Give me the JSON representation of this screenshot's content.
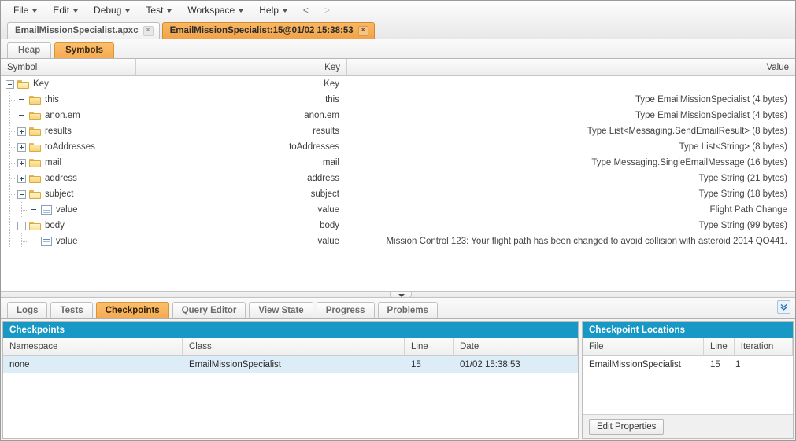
{
  "menubar": {
    "items": [
      {
        "label": "File",
        "caret": true
      },
      {
        "label": "Edit",
        "caret": true
      },
      {
        "label": "Debug",
        "caret": true
      },
      {
        "label": "Test",
        "caret": true
      },
      {
        "label": "Workspace",
        "caret": true
      },
      {
        "label": "Help",
        "caret": true
      }
    ],
    "nav_prev": "<",
    "nav_next": ">"
  },
  "file_tabs": [
    {
      "label": "EmailMissionSpecialist.apxc",
      "close": "×",
      "active": false
    },
    {
      "label": "EmailMissionSpecialist:15@01/02 15:38:53",
      "close": "×",
      "active": true
    }
  ],
  "sub_tabs": [
    {
      "label": "Heap",
      "active": false
    },
    {
      "label": "Symbols",
      "active": true
    }
  ],
  "symbols_grid": {
    "columns": [
      "Symbol",
      "Key",
      "Value"
    ],
    "rows": [
      {
        "symbol": "Key",
        "key": "Key",
        "value": "",
        "depth": 0,
        "twisty": "minus",
        "icon": "folder-open"
      },
      {
        "symbol": "this",
        "key": "this",
        "value": "Type EmailMissionSpecialist (4 bytes)",
        "depth": 1,
        "twisty": "none",
        "icon": "folder"
      },
      {
        "symbol": "anon.em",
        "key": "anon.em",
        "value": "Type EmailMissionSpecialist (4 bytes)",
        "depth": 1,
        "twisty": "none",
        "icon": "folder"
      },
      {
        "symbol": "results",
        "key": "results",
        "value": "Type List<Messaging.SendEmailResult> (8 bytes)",
        "depth": 1,
        "twisty": "plus",
        "icon": "folder"
      },
      {
        "symbol": "toAddresses",
        "key": "toAddresses",
        "value": "Type List<String> (8 bytes)",
        "depth": 1,
        "twisty": "plus",
        "icon": "folder"
      },
      {
        "symbol": "mail",
        "key": "mail",
        "value": "Type Messaging.SingleEmailMessage (16 bytes)",
        "depth": 1,
        "twisty": "plus",
        "icon": "folder"
      },
      {
        "symbol": "address",
        "key": "address",
        "value": "Type String (21 bytes)",
        "depth": 1,
        "twisty": "plus",
        "icon": "folder"
      },
      {
        "symbol": "subject",
        "key": "subject",
        "value": "Type String (18 bytes)",
        "depth": 1,
        "twisty": "minus",
        "icon": "folder-open"
      },
      {
        "symbol": "value",
        "key": "value",
        "value": "Flight Path Change",
        "depth": 2,
        "twisty": "none",
        "icon": "doc"
      },
      {
        "symbol": "body",
        "key": "body",
        "value": "Type String (99 bytes)",
        "depth": 1,
        "twisty": "minus",
        "icon": "folder-open"
      },
      {
        "symbol": "value",
        "key": "value",
        "value": "Mission Control 123: Your flight path has been changed to avoid collision with asteroid 2014 QO441.",
        "depth": 2,
        "twisty": "none",
        "icon": "doc"
      }
    ]
  },
  "bottom_tabs": [
    {
      "label": "Logs",
      "active": false
    },
    {
      "label": "Tests",
      "active": false
    },
    {
      "label": "Checkpoints",
      "active": true
    },
    {
      "label": "Query Editor",
      "active": false
    },
    {
      "label": "View State",
      "active": false
    },
    {
      "label": "Progress",
      "active": false
    },
    {
      "label": "Problems",
      "active": false
    }
  ],
  "expand_icon": "»",
  "checkpoints": {
    "title": "Checkpoints",
    "columns": [
      "Namespace",
      "Class",
      "Line",
      "Date"
    ],
    "rows": [
      {
        "namespace": "none",
        "class": "EmailMissionSpecialist",
        "line": "15",
        "date": "01/02 15:38:53",
        "selected": true
      }
    ]
  },
  "checkpoint_locations": {
    "title": "Checkpoint Locations",
    "columns": [
      "File",
      "Line",
      "Iteration"
    ],
    "rows": [
      {
        "file": "EmailMissionSpecialist",
        "line": "15",
        "iteration": "1",
        "selected": false
      }
    ],
    "edit_properties_label": "Edit Properties"
  },
  "colors": {
    "panel_header": "#1898c4",
    "active_tab": "#f5aa52",
    "selected_row": "#dcedf7"
  }
}
